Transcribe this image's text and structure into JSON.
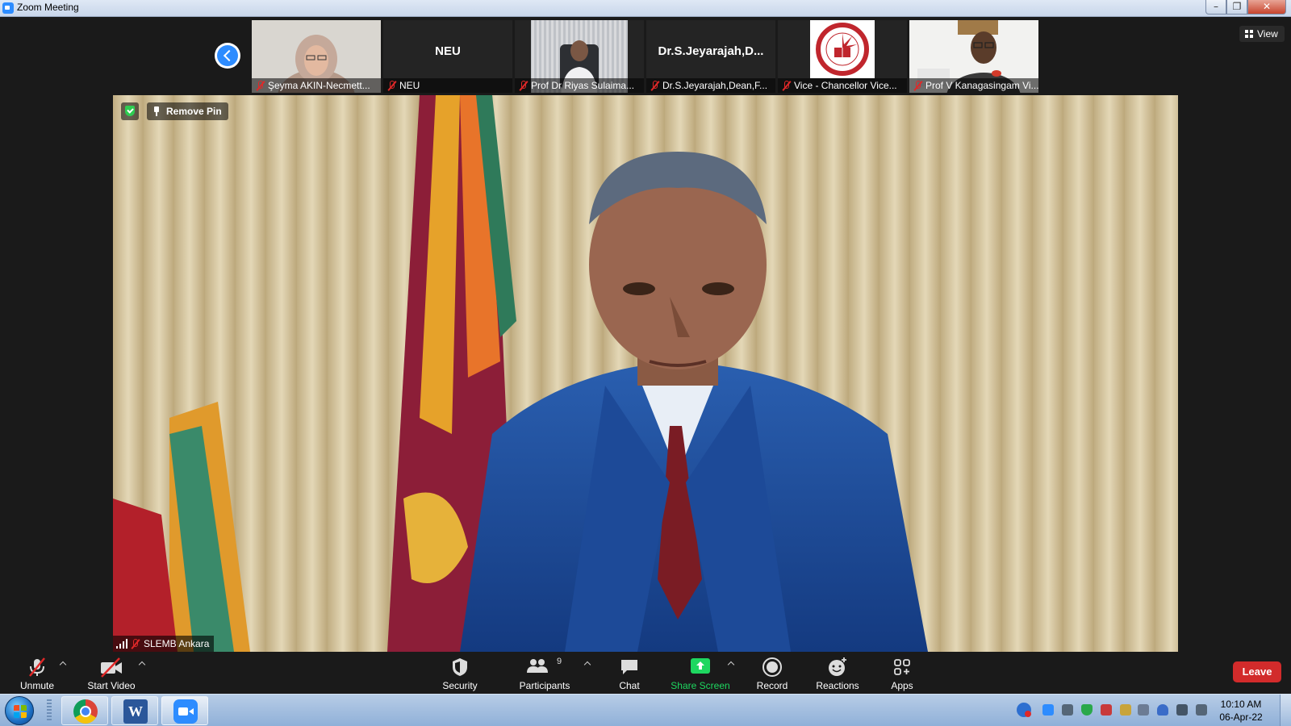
{
  "window": {
    "title": "Zoom Meeting"
  },
  "thumbnails": [
    {
      "name": "Şeyma AKIN-Necmett...",
      "type": "video"
    },
    {
      "name": "NEU",
      "display_name": "NEU",
      "type": "name"
    },
    {
      "name": "Prof Dr Riyas Sulaima...",
      "type": "video"
    },
    {
      "name": "Dr.S.Jeyarajah,Dean,F...",
      "display_name": "Dr.S.Jeyarajah,D...",
      "type": "name"
    },
    {
      "name": "Vice - Chancellor Vice...",
      "type": "logo"
    },
    {
      "name": "Prof V Kanagasingam Vi...",
      "type": "video"
    }
  ],
  "view_button": {
    "label": "View"
  },
  "main_video": {
    "remove_pin_label": "Remove Pin",
    "speaker_name": "SLEMB Ankara"
  },
  "toolbar": {
    "unmute": "Unmute",
    "start_video": "Start Video",
    "security": "Security",
    "participants": "Participants",
    "participants_count": "9",
    "chat": "Chat",
    "share_screen": "Share Screen",
    "record": "Record",
    "reactions": "Reactions",
    "apps": "Apps",
    "leave": "Leave"
  },
  "colors": {
    "zoom_blue": "#2d8cff",
    "share_green": "#1ed760",
    "leave_red": "#d22b2b",
    "mute_red": "#e02828"
  },
  "taskbar": {
    "apps": [
      "chrome-icon",
      "word-icon",
      "zoom-icon"
    ],
    "word_letter": "W",
    "clock_time": "10:10 AM",
    "clock_date": "06-Apr-22"
  }
}
